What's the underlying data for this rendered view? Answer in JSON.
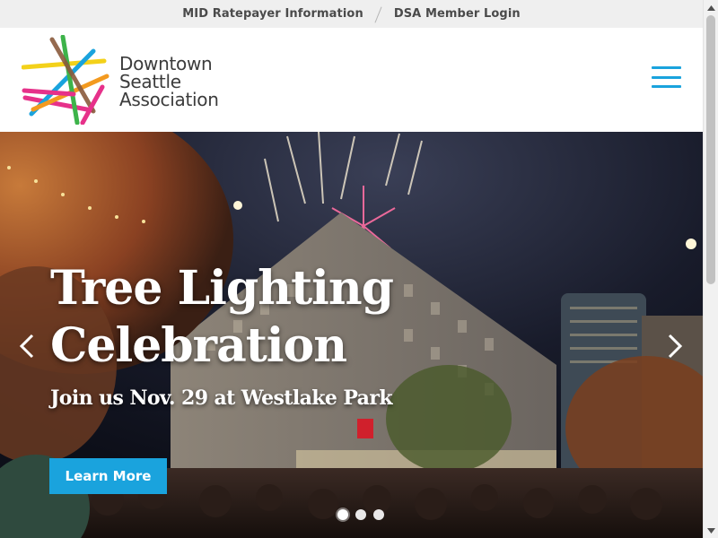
{
  "utility_bar": {
    "links": [
      {
        "label": "MID Ratepayer Information"
      },
      {
        "label": "DSA Member Login"
      }
    ]
  },
  "header": {
    "logo": {
      "line1": "Downtown",
      "line2": "Seattle",
      "line3": "Association",
      "colors": [
        "#f3d11a",
        "#e6318a",
        "#1aa3dd",
        "#f39a1f",
        "#3db34a",
        "#8a5a3c"
      ]
    },
    "menu_icon": "hamburger-icon",
    "accent_color": "#1aa3dd"
  },
  "hero": {
    "title_line1": "Tree Lighting",
    "title_line2": "Celebration",
    "subtitle": "Join us Nov. 29 at Westlake Park",
    "cta_label": "Learn More",
    "prev_icon": "chevron-left-icon",
    "next_icon": "chevron-right-icon",
    "slides": [
      {
        "active": true
      },
      {
        "active": false
      },
      {
        "active": false
      }
    ]
  },
  "scrollbar": {
    "up_icon": "scroll-up-icon",
    "down_icon": "scroll-down-icon"
  }
}
